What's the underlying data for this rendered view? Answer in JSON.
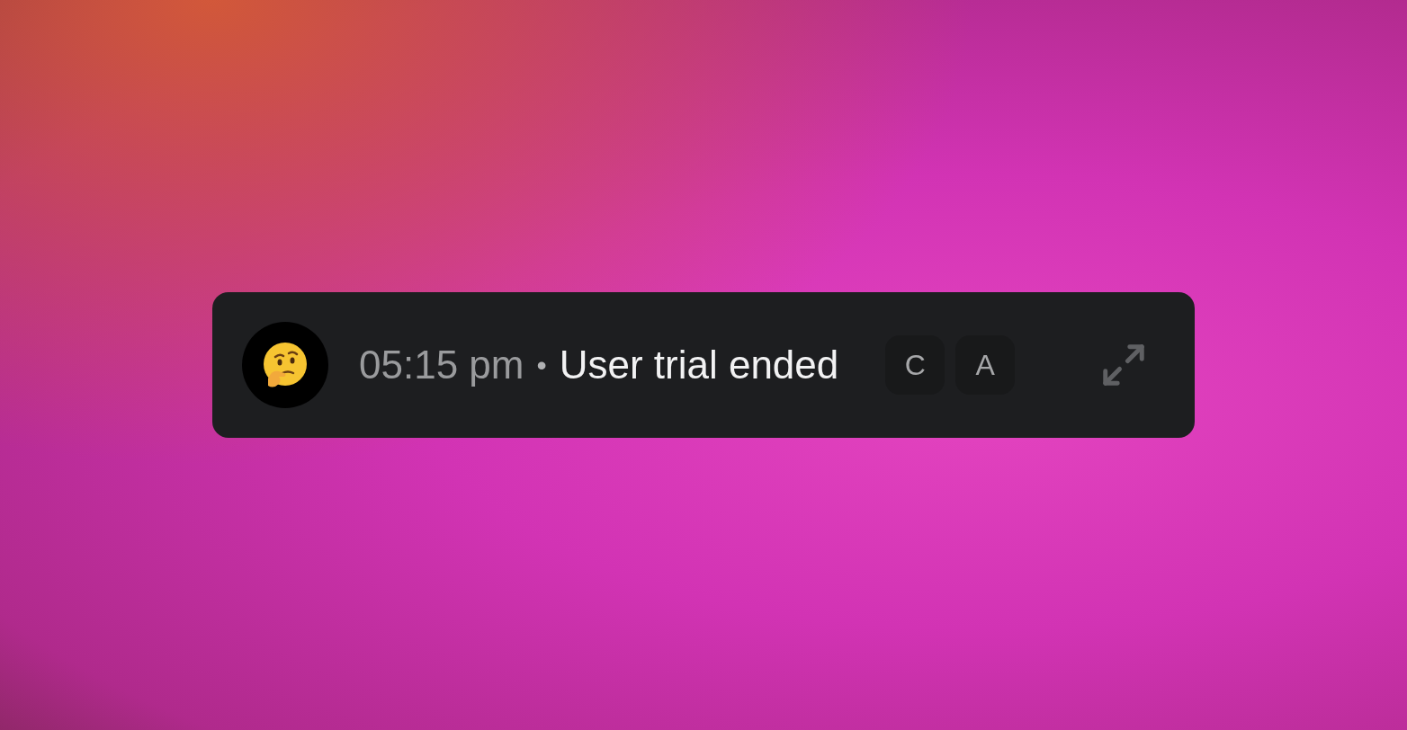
{
  "notification": {
    "time": "05:15 pm",
    "separator": "•",
    "message": "User trial ended",
    "keys": [
      {
        "label": "C"
      },
      {
        "label": "A"
      }
    ]
  }
}
